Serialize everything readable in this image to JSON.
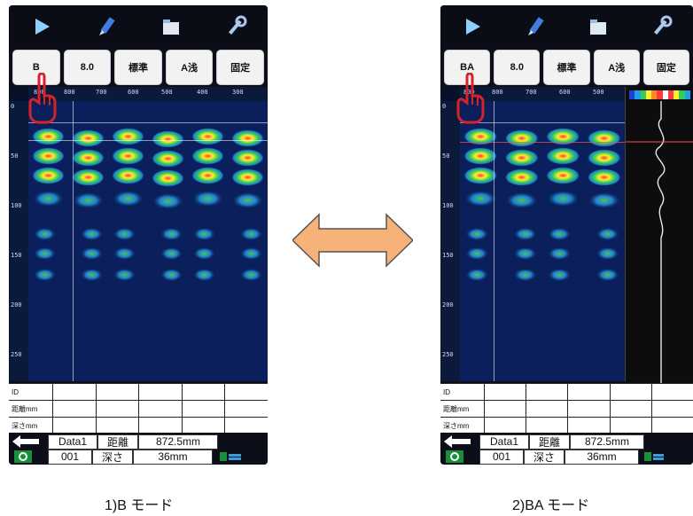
{
  "left": {
    "buttons": [
      "B",
      "8.0",
      "標準",
      "A浅",
      "固定"
    ],
    "top_ticks": [
      "800",
      "800",
      "700",
      "600",
      "500",
      "400",
      "300"
    ],
    "depth_ticks": [
      "0",
      "50",
      "100",
      "150",
      "200",
      "250"
    ],
    "table_rows": [
      "ID",
      "距離mm",
      "深さmm"
    ],
    "status": {
      "data_name": "Data1",
      "number": "001",
      "dist_label": "距離",
      "dist_value": "872.5mm",
      "depth_label": "深さ",
      "depth_value": "36mm"
    },
    "caption": "1)B モード"
  },
  "right": {
    "buttons": [
      "BA",
      "8.0",
      "標準",
      "A浅",
      "固定"
    ],
    "top_ticks": [
      "800",
      "800",
      "700",
      "600",
      "500"
    ],
    "depth_ticks": [
      "0",
      "50",
      "100",
      "150",
      "200",
      "250"
    ],
    "table_rows": [
      "ID",
      "距離mm",
      "深さmm"
    ],
    "status": {
      "data_name": "Data1",
      "number": "001",
      "dist_label": "距離",
      "dist_value": "872.5mm",
      "depth_label": "深さ",
      "depth_value": "36mm"
    },
    "caption": "2)BA モード"
  },
  "colors": {
    "accent_arrow": "#f7b27a",
    "hand": "#d8222a"
  },
  "icons": [
    "play-icon",
    "pencil-icon",
    "folder-icon",
    "wrench-icon"
  ]
}
